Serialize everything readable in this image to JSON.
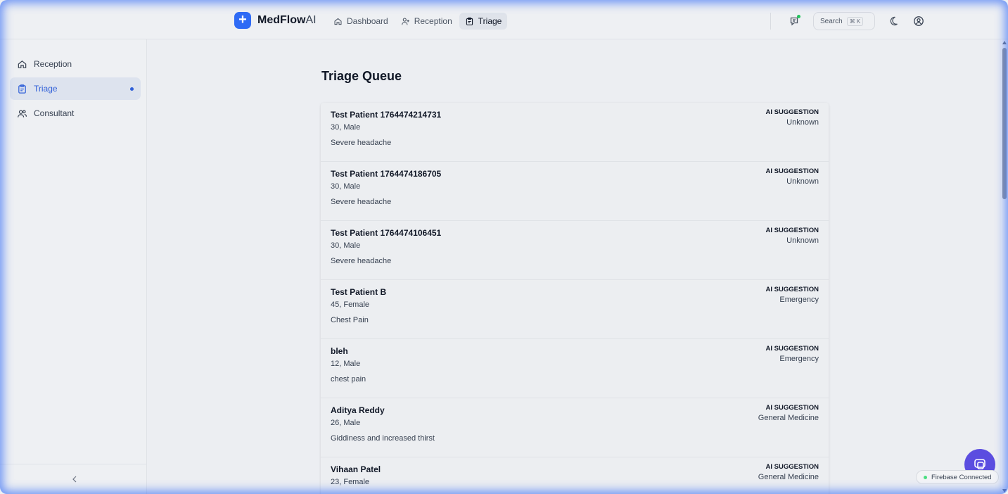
{
  "brand": {
    "name_main": "MedFlow",
    "name_suffix": "AI",
    "logo_symbol": "+"
  },
  "nav": {
    "items": [
      {
        "label": "Dashboard",
        "icon": "home-icon"
      },
      {
        "label": "Reception",
        "icon": "user-plus-icon"
      },
      {
        "label": "Triage",
        "icon": "clipboard-icon",
        "active": true
      }
    ]
  },
  "header": {
    "search_label": "Search",
    "search_shortcut": "⌘ K"
  },
  "sidebar": {
    "items": [
      {
        "label": "Reception",
        "icon": "home-icon"
      },
      {
        "label": "Triage",
        "icon": "clipboard-icon",
        "active": true
      },
      {
        "label": "Consultant",
        "icon": "users-icon"
      }
    ]
  },
  "main": {
    "title": "Triage Queue",
    "ai_label": "AI SUGGESTION",
    "patients": [
      {
        "name": "Test Patient 1764474214731",
        "meta": "30, Male",
        "complaint": "Severe headache",
        "suggestion": "Unknown"
      },
      {
        "name": "Test Patient 1764474186705",
        "meta": "30, Male",
        "complaint": "Severe headache",
        "suggestion": "Unknown"
      },
      {
        "name": "Test Patient 1764474106451",
        "meta": "30, Male",
        "complaint": "Severe headache",
        "suggestion": "Unknown"
      },
      {
        "name": "Test Patient B",
        "meta": "45, Female",
        "complaint": "Chest Pain",
        "suggestion": "Emergency"
      },
      {
        "name": "bleh",
        "meta": "12, Male",
        "complaint": "chest pain",
        "suggestion": "Emergency"
      },
      {
        "name": "Aditya Reddy",
        "meta": "26, Male",
        "complaint": "Giddiness and increased thirst",
        "suggestion": "General Medicine"
      },
      {
        "name": "Vihaan Patel",
        "meta": "23, Female",
        "complaint": "",
        "suggestion": "General Medicine"
      }
    ]
  },
  "status": {
    "firebase": "Firebase Connected"
  },
  "colors": {
    "accent": "#2f6bf5",
    "fab": "#5b4de0",
    "status_dot": "#4ade80"
  }
}
